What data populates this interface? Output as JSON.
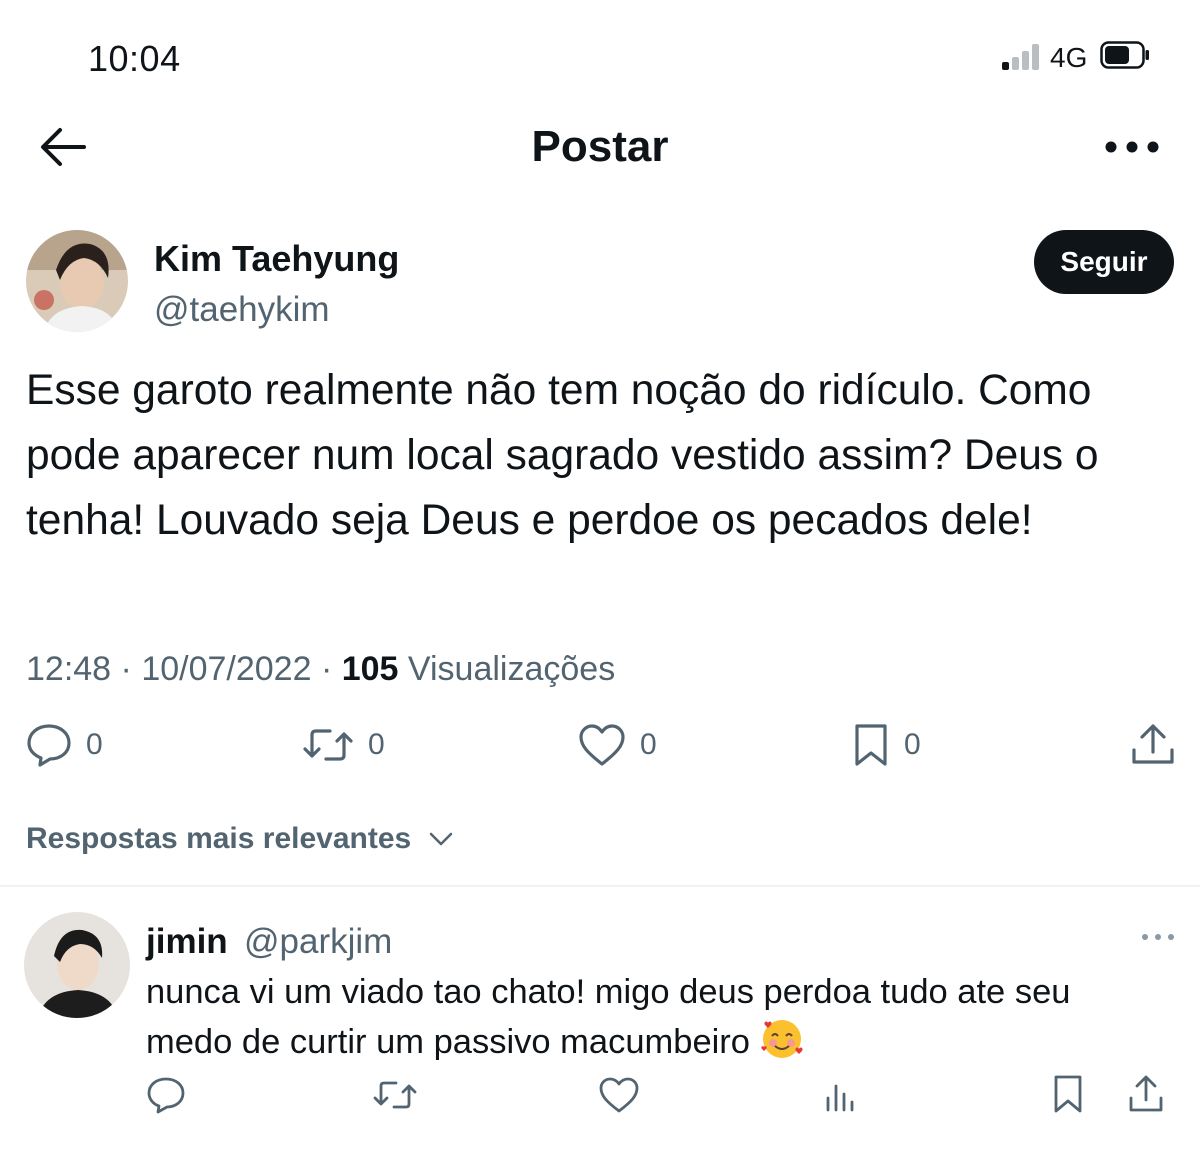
{
  "status_bar": {
    "time": "10:04",
    "network": "4G"
  },
  "header": {
    "title": "Postar"
  },
  "tweet": {
    "author_name": "Kim Taehyung",
    "author_handle": "@taehykim",
    "follow_label": "Seguir",
    "text": "Esse garoto realmente não tem noção do ridículo. Como pode aparecer num local sagrado vestido assim? Deus o tenha! Louvado seja Deus e perdoe os pecados dele!",
    "time": "12:48",
    "date": "10/07/2022",
    "separator": "·",
    "views_count": "105",
    "views_label": "Visualizações",
    "replies": "0",
    "retweets": "0",
    "likes": "0",
    "bookmarks": "0"
  },
  "replies_sort": {
    "label": "Respostas mais relevantes"
  },
  "reply": {
    "author_name": "jimin",
    "author_handle": "@parkjim",
    "text": "nunca vi um viado tao chato! migo deus perdoa tudo ate seu medo de curtir um passivo macumbeiro"
  },
  "colors": {
    "primary_text": "#0f1419",
    "secondary_text": "#536471",
    "divider": "#eff3f4",
    "button": "#0f1419"
  }
}
